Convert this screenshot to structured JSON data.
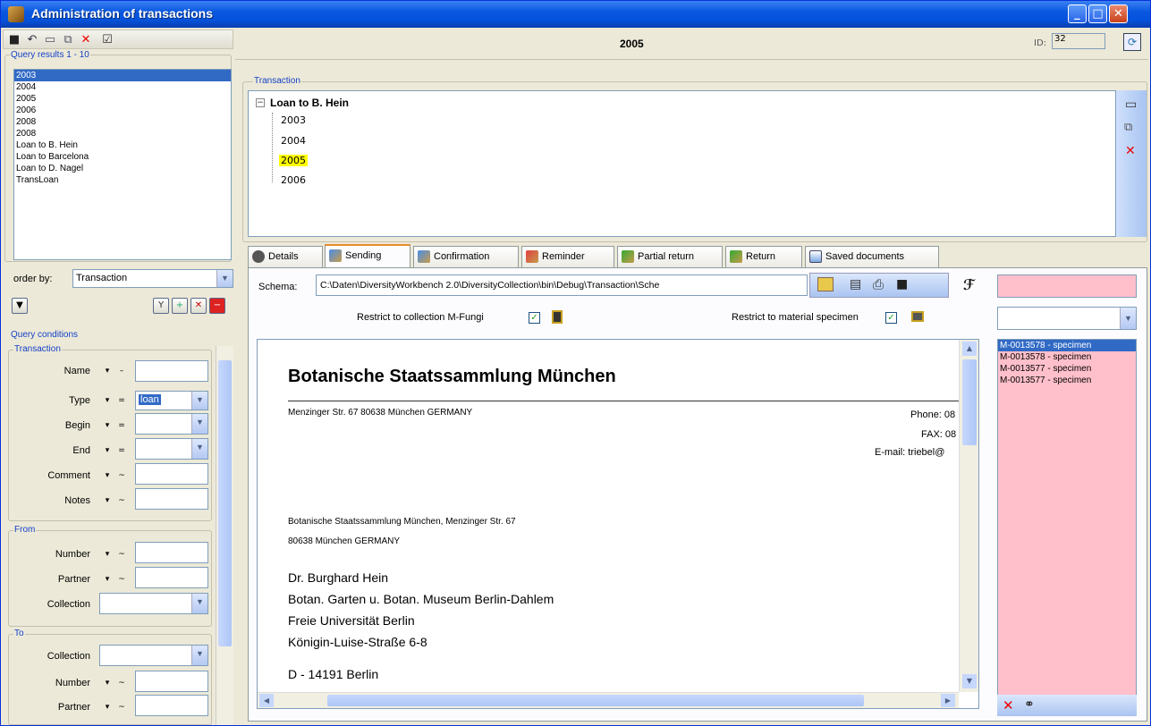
{
  "window": {
    "title": "Administration of transactions"
  },
  "header": {
    "record_title": "2005",
    "id_label": "ID:",
    "id_value": "32"
  },
  "query": {
    "results_label": "Query results  1 - 10",
    "results": [
      "2003",
      "2004",
      "2005",
      "2006",
      "2008",
      "2008",
      "Loan to B. Hein",
      "Loan to Barcelona",
      "Loan to D. Nagel",
      "TransLoan"
    ],
    "order_by_label": "order by:",
    "order_by_value": "Transaction",
    "conditions_label": "Query conditions",
    "transaction_group": "Transaction",
    "from_group": "From",
    "to_group": "To",
    "fields": {
      "name": "Name",
      "type": "Type",
      "type_value": "loan",
      "begin": "Begin",
      "end": "End",
      "comment": "Comment",
      "notes": "Notes",
      "number": "Number",
      "partner": "Partner",
      "collection": "Collection"
    }
  },
  "transaction": {
    "group_label": "Transaction",
    "root": "Loan to B. Hein",
    "children": [
      "2003",
      "2004",
      "2005",
      "2006"
    ]
  },
  "tabs": [
    "Details",
    "Sending",
    "Confirmation",
    "Reminder",
    "Partial return",
    "Return",
    "Saved documents"
  ],
  "sending": {
    "schema_label": "Schema:",
    "schema_value": "C:\\Daten\\DiversityWorkbench 2.0\\DiversityCollection\\bin\\Debug\\Transaction\\Sche",
    "restrict_collection": "Restrict to collection M-Fungi",
    "restrict_material": "Restrict to material specimen"
  },
  "document": {
    "heading": "Botanische Staatssammlung München",
    "address_line": "Menzinger Str. 67 80638 München GERMANY",
    "phone": "Phone: 08",
    "fax": "FAX: 08",
    "email": "E-mail: triebel@",
    "sender_line1": "Botanische Staatssammlung München, Menzinger Str. 67",
    "sender_line2": "80638 München GERMANY",
    "recipient": [
      "Dr. Burghard Hein",
      "Botan. Garten u. Botan. Museum Berlin-Dahlem",
      "Freie Universität Berlin",
      "Königin-Luise-Straße 6-8"
    ],
    "city": "D - 14191 Berlin"
  },
  "specimens": [
    "M-0013578 - specimen",
    "M-0013578 - specimen",
    "M-0013577 - specimen",
    "M-0013577 - specimen"
  ],
  "colors": {
    "accent": "#316ac5",
    "pink": "#ffc0cb",
    "highlight": "#ffff00"
  }
}
